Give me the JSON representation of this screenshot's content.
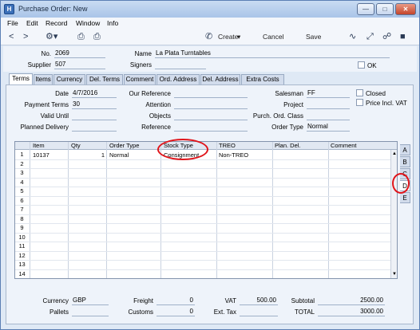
{
  "window": {
    "title": "Purchase Order: New"
  },
  "menu": [
    "File",
    "Edit",
    "Record",
    "Window",
    "Info"
  ],
  "toolbar": {
    "create": "Create",
    "cancel": "Cancel",
    "save": "Save"
  },
  "header": {
    "no_label": "No.",
    "no_value": "2069",
    "name_label": "Name",
    "name_value": "La Plata Turntables",
    "supplier_label": "Supplier",
    "supplier_value": "507",
    "signers_label": "Signers",
    "signers_value": "",
    "ok_label": "OK"
  },
  "tabs": [
    "Terms",
    "Items",
    "Currency",
    "Del. Terms",
    "Comment",
    "Ord. Address",
    "Del. Address",
    "Extra Costs"
  ],
  "terms": {
    "date_label": "Date",
    "date_value": "4/7/2016",
    "payment_terms_label": "Payment Terms",
    "payment_terms_value": "30",
    "valid_until_label": "Valid Until",
    "valid_until_value": "",
    "planned_delivery_label": "Planned Delivery",
    "planned_delivery_value": "",
    "our_reference_label": "Our Reference",
    "our_reference_value": "",
    "attention_label": "Attention",
    "attention_value": "",
    "objects_label": "Objects",
    "objects_value": "",
    "reference_label": "Reference",
    "reference_value": "",
    "salesman_label": "Salesman",
    "salesman_value": "FF",
    "project_label": "Project",
    "project_value": "",
    "purch_ord_class_label": "Purch. Ord. Class",
    "purch_ord_class_value": "",
    "order_type_label": "Order Type",
    "order_type_value": "Normal",
    "closed_label": "Closed",
    "price_incl_vat_label": "Price Incl. VAT"
  },
  "grid": {
    "columns": [
      "Item",
      "Qty",
      "Order Type",
      "Stock Type",
      "TREO",
      "Plan. Del.",
      "Comment"
    ],
    "row_numbers": [
      "1",
      "2",
      "3",
      "4",
      "5",
      "6",
      "7",
      "8",
      "9",
      "10",
      "11",
      "12",
      "13",
      "14"
    ],
    "rows": [
      {
        "item": "10137",
        "qty": "1",
        "order_type": "Normal",
        "stock_type": "Consignment",
        "treo": "Non-TREO",
        "plan_del": "",
        "comment": ""
      }
    ]
  },
  "side_tabs": [
    "A",
    "B",
    "C",
    "D",
    "E"
  ],
  "footer": {
    "currency_label": "Currency",
    "currency_value": "GBP",
    "pallets_label": "Pallets",
    "pallets_value": "",
    "freight_label": "Freight",
    "freight_value": "0",
    "customs_label": "Customs",
    "customs_value": "0",
    "vat_label": "VAT",
    "vat_value": "500.00",
    "ext_tax_label": "Ext. Tax",
    "ext_tax_value": "",
    "subtotal_label": "Subtotal",
    "subtotal_value": "2500.00",
    "total_label": "TOTAL",
    "total_value": "3000.00"
  },
  "colors": {
    "highlight_ring": "#e0141a",
    "window_bg": "#dfe9f5"
  }
}
